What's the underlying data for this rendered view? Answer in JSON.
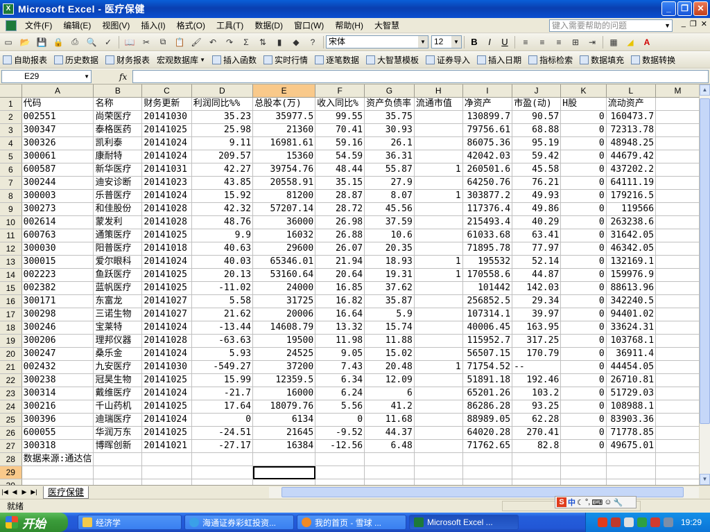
{
  "window": {
    "app_title": "Microsoft Excel - 医疗保健",
    "app_icon": "excel-icon"
  },
  "menu": {
    "items": [
      "文件(F)",
      "编辑(E)",
      "视图(V)",
      "插入(I)",
      "格式(O)",
      "工具(T)",
      "数据(D)",
      "窗口(W)",
      "帮助(H)",
      "大智慧"
    ],
    "help_placeholder": "键入需要帮助的问题"
  },
  "format_toolbar": {
    "font_name": "宋体",
    "font_size": "12",
    "bold": "B",
    "italic": "I",
    "underline": "U"
  },
  "plugin_toolbar": {
    "items": [
      "自助报表",
      "历史数据",
      "财务报表",
      "宏观数据库",
      "插入函数",
      "实时行情",
      "逐笔数据",
      "大智慧模板",
      "证券导入",
      "插入日期",
      "指标检索",
      "数据填充",
      "数据转换"
    ]
  },
  "formula_bar": {
    "name_box": "E29",
    "fx_label": "fx",
    "formula": ""
  },
  "chart_data": {
    "type": "table",
    "columns": [
      "A",
      "B",
      "C",
      "D",
      "E",
      "F",
      "G",
      "H",
      "I",
      "J",
      "K",
      "L",
      "M"
    ],
    "header_row": [
      "代码",
      "名称",
      "财务更新",
      "利润同比%%",
      "总股本(万)",
      "收入同比%",
      "资产负债率",
      "流通市值",
      "净资产",
      "市盈(动)",
      "H股",
      "流动资产",
      ""
    ],
    "rows": [
      [
        "002551",
        "尚荣医疗",
        "20141030",
        "35.23",
        "35977.5",
        "99.55",
        "35.75",
        "",
        "130899.7",
        "90.57",
        "0",
        "160473.7",
        ""
      ],
      [
        "300347",
        "泰格医药",
        "20141025",
        "25.98",
        "21360",
        "70.41",
        "30.93",
        "",
        "79756.61",
        "68.88",
        "0",
        "72313.78",
        ""
      ],
      [
        "300326",
        "凯利泰",
        "20141024",
        "9.11",
        "16981.61",
        "59.16",
        "26.1",
        "",
        "86075.36",
        "95.19",
        "0",
        "48948.25",
        ""
      ],
      [
        "300061",
        "康耐特",
        "20141024",
        "209.57",
        "15360",
        "54.59",
        "36.31",
        "",
        "42042.03",
        "59.42",
        "0",
        "44679.42",
        ""
      ],
      [
        "600587",
        "新华医疗",
        "20141031",
        "42.27",
        "39754.76",
        "48.44",
        "55.87",
        "1",
        "260501.6",
        "45.58",
        "0",
        "437202.2",
        ""
      ],
      [
        "300244",
        "迪安诊断",
        "20141023",
        "43.85",
        "20558.91",
        "35.15",
        "27.9",
        "",
        "64250.76",
        "76.21",
        "0",
        "64111.19",
        ""
      ],
      [
        "300003",
        "乐普医疗",
        "20141024",
        "15.92",
        "81200",
        "28.87",
        "8.07",
        "1",
        "303877.2",
        "49.93",
        "0",
        "179216.5",
        ""
      ],
      [
        "300273",
        "和佳股份",
        "20141028",
        "42.32",
        "57207.14",
        "28.72",
        "45.56",
        "",
        "117376.4",
        "49.86",
        "0",
        "119566",
        ""
      ],
      [
        "002614",
        "蒙发利",
        "20141028",
        "48.76",
        "36000",
        "26.98",
        "37.59",
        "",
        "215493.4",
        "40.29",
        "0",
        "263238.6",
        ""
      ],
      [
        "600763",
        "通策医疗",
        "20141025",
        "9.9",
        "16032",
        "26.88",
        "10.6",
        "",
        "61033.68",
        "63.41",
        "0",
        "31642.05",
        ""
      ],
      [
        "300030",
        "阳普医疗",
        "20141018",
        "40.63",
        "29600",
        "26.07",
        "20.35",
        "",
        "71895.78",
        "77.97",
        "0",
        "46342.05",
        ""
      ],
      [
        "300015",
        "爱尔眼科",
        "20141024",
        "40.03",
        "65346.01",
        "21.94",
        "18.93",
        "1",
        "195532",
        "52.14",
        "0",
        "132169.1",
        ""
      ],
      [
        "002223",
        "鱼跃医疗",
        "20141025",
        "20.13",
        "53160.64",
        "20.64",
        "19.31",
        "1",
        "170558.6",
        "44.87",
        "0",
        "159976.9",
        ""
      ],
      [
        "002382",
        "蓝帆医疗",
        "20141025",
        "-11.02",
        "24000",
        "16.85",
        "37.62",
        "",
        "101442",
        "142.03",
        "0",
        "88613.96",
        ""
      ],
      [
        "300171",
        "东富龙",
        "20141027",
        "5.58",
        "31725",
        "16.82",
        "35.87",
        "",
        "256852.5",
        "29.34",
        "0",
        "342240.5",
        ""
      ],
      [
        "300298",
        "三诺生物",
        "20141027",
        "21.62",
        "20006",
        "16.64",
        "5.9",
        "",
        "107314.1",
        "39.97",
        "0",
        "94401.02",
        ""
      ],
      [
        "300246",
        "宝莱特",
        "20141024",
        "-13.44",
        "14608.79",
        "13.32",
        "15.74",
        "",
        "40006.45",
        "163.95",
        "0",
        "33624.31",
        ""
      ],
      [
        "300206",
        "理邦仪器",
        "20141028",
        "-63.63",
        "19500",
        "11.98",
        "11.88",
        "",
        "115952.7",
        "317.25",
        "0",
        "103768.1",
        ""
      ],
      [
        "300247",
        "桑乐金",
        "20141024",
        "5.93",
        "24525",
        "9.05",
        "15.02",
        "",
        "56507.15",
        "170.79",
        "0",
        "36911.4",
        ""
      ],
      [
        "002432",
        "九安医疗",
        "20141030",
        "-549.27",
        "37200",
        "7.43",
        "20.48",
        "1",
        "71754.52",
        "--",
        "0",
        "44454.05",
        ""
      ],
      [
        "300238",
        "冠昊生物",
        "20141025",
        "15.99",
        "12359.5",
        "6.34",
        "12.09",
        "",
        "51891.18",
        "192.46",
        "0",
        "26710.81",
        ""
      ],
      [
        "300314",
        "戴维医疗",
        "20141024",
        "-21.7",
        "16000",
        "6.24",
        "6",
        "",
        "65201.26",
        "103.2",
        "0",
        "51729.03",
        ""
      ],
      [
        "300216",
        "千山药机",
        "20141025",
        "17.64",
        "18079.76",
        "5.56",
        "41.2",
        "",
        "86286.28",
        "93.25",
        "0",
        "108988.1",
        ""
      ],
      [
        "300396",
        "迪瑞医疗",
        "20141024",
        "0",
        "6134",
        "0",
        "11.68",
        "",
        "88989.05",
        "62.28",
        "0",
        "83903.36",
        ""
      ],
      [
        "600055",
        "华润万东",
        "20141025",
        "-24.51",
        "21645",
        "-9.52",
        "44.37",
        "",
        "64020.28",
        "270.41",
        "0",
        "71778.85",
        ""
      ],
      [
        "300318",
        "博晖创新",
        "20141021",
        "-27.17",
        "16384",
        "-12.56",
        "6.48",
        "",
        "71762.65",
        "82.8",
        "0",
        "49675.01",
        ""
      ]
    ],
    "footer_row": [
      "数据来源:通达信"
    ],
    "selected_cell": "E29",
    "last_visible_row": "30"
  },
  "sheet_tabs": {
    "active": "医疗保健"
  },
  "status": {
    "ready": "就绪"
  },
  "ime": {
    "s": "S",
    "zh": "中"
  },
  "taskbar": {
    "start": "开始",
    "items": [
      "经济学",
      "海通证券彩虹投资...",
      "我的首页 - 雪球 ...",
      "Microsoft Excel ..."
    ],
    "clock": "19:29"
  },
  "colors": {
    "header_bg": "#ece9d8",
    "selected_header": "#f9c98a",
    "titlebar": "#0b4fd1",
    "taskbar": "#245edb",
    "start_green": "#3b9c3a"
  }
}
